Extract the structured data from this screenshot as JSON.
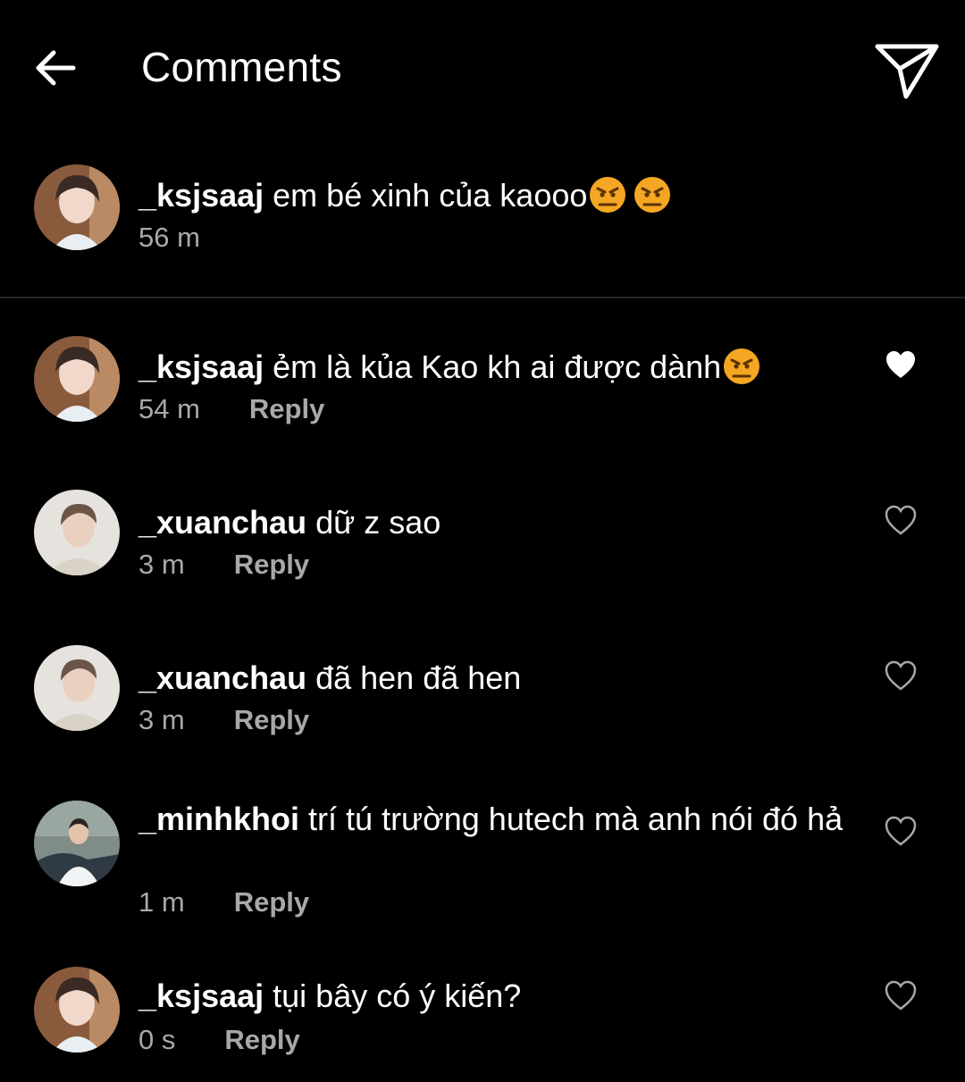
{
  "header": {
    "title": "Comments",
    "back_icon": "arrow-left-icon",
    "share_icon": "paper-plane-icon"
  },
  "caption": {
    "username": "_ksjsaaj",
    "text": "em bé xinh của kaooo",
    "emojis": [
      "angry-face-emoji",
      "angry-face-emoji"
    ],
    "time": "56 m"
  },
  "comments": [
    {
      "username": "_ksjsaaj",
      "text": "ẻm là kủa Kao kh ai được dành",
      "emoji": "angry-face-emoji",
      "time": "54 m",
      "reply_label": "Reply",
      "liked": true
    },
    {
      "username": "_xuanchau",
      "text": "dữ z sao",
      "time": "3 m",
      "reply_label": "Reply",
      "liked": false
    },
    {
      "username": "_xuanchau",
      "text": "đã hen đã hen",
      "time": "3 m",
      "reply_label": "Reply",
      "liked": false
    },
    {
      "username": "_minhkhoi",
      "text": "trí tú trường hutech mà anh nói đó hả",
      "time": "1 m",
      "reply_label": "Reply",
      "liked": false
    },
    {
      "username": "_ksjsaaj",
      "text": "tụi bây có ý kiến?",
      "time": "0 s",
      "reply_label": "Reply",
      "liked": false
    }
  ],
  "colors": {
    "background": "#000000",
    "text": "#ffffff",
    "secondary_text": "#a8a8a8",
    "divider": "#262626",
    "emoji": "#f5a623"
  }
}
